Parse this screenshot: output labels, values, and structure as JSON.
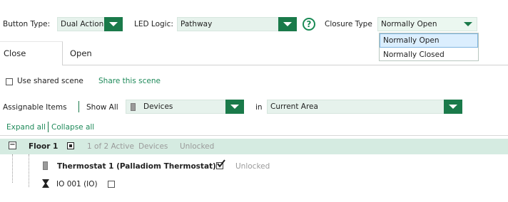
{
  "toolbar": {
    "button_type_label": "Button Type:",
    "button_type_value": "Dual Action",
    "led_logic_label": "LED Logic:",
    "led_logic_value": "Pathway",
    "help_symbol": "?",
    "closure_type_label": "Closure Type",
    "closure_type_value": "Normally Open",
    "closure_type_options": [
      "Normally Open",
      "Normally Closed"
    ]
  },
  "tabs": [
    {
      "label": "Close",
      "active": true
    },
    {
      "label": "Open",
      "active": false
    }
  ],
  "scene": {
    "use_shared_label": "Use shared scene",
    "share_link": "Share this scene"
  },
  "filter": {
    "assignable_label": "Assignable Items",
    "show_all_label": "Show All",
    "devices_value": "Devices",
    "in_label": "in",
    "area_value": "Current Area"
  },
  "tree_controls": {
    "expand_all": "Expand all",
    "collapse_all": "Collapse all"
  },
  "tree": {
    "floor": {
      "toggle_symbol": "−",
      "label": "Floor 1",
      "active_text": "1 of 2 Active",
      "devices_text": "Devices",
      "lock_text": "Unlocked"
    },
    "thermostat": {
      "label": "Thermostat 1 (Palladiom Thermostat)",
      "lock_text": "Unlocked"
    },
    "io": {
      "label": "IO 001 (IO)"
    }
  },
  "colors": {
    "accent": "#1a7a4a",
    "combo_bg": "#e6f2ec",
    "floor_row_bg": "#d5ebe1",
    "link": "#1f8a5a"
  },
  "icons": [
    "chevron-down-icon",
    "help-icon",
    "device-icon",
    "collapse-icon",
    "check-icon",
    "io-icon"
  ]
}
